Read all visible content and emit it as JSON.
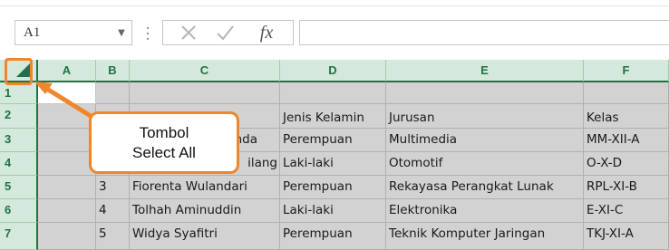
{
  "toolbar": {
    "name_box_value": "A1",
    "name_box_dropdown": "▼",
    "separator": "⋮",
    "cancel_icon": "close-icon",
    "enter_icon": "check-icon",
    "insert_function_label": "fx"
  },
  "grid": {
    "columns": [
      "A",
      "B",
      "C",
      "D",
      "E",
      "F"
    ],
    "rows": [
      "1",
      "2",
      "3",
      "4",
      "5",
      "6",
      "7"
    ],
    "cells": {
      "row1": {
        "A": "",
        "B": "",
        "C": "",
        "D": "",
        "E": "",
        "F": ""
      },
      "row2": {
        "A": "",
        "B": "",
        "C": "",
        "D": "Jenis Kelamin",
        "E": "Jurusan",
        "F": "Kelas"
      },
      "row3": {
        "A": "",
        "B": "",
        "C": "nda",
        "D": "Perempuan",
        "E": "Multimedia",
        "F": "MM-XII-A"
      },
      "row4": {
        "A": "",
        "B": "",
        "C": "ilang",
        "D": "Laki-laki",
        "E": "Otomotif",
        "F": "O-X-D"
      },
      "row5": {
        "A": "",
        "B": "3",
        "C": "Fiorenta Wulandari",
        "D": "Perempuan",
        "E": "Rekayasa Perangkat Lunak",
        "F": "RPL-XI-B"
      },
      "row6": {
        "A": "",
        "B": "4",
        "C": "Tolhah Aminuddin",
        "D": "Laki-laki",
        "E": "Elektronika",
        "F": "E-XI-C"
      },
      "row7": {
        "A": "",
        "B": "5",
        "C": "Widya Syafitri",
        "D": "Perempuan",
        "E": "Teknik Komputer Jaringan",
        "F": "TKJ-XI-A"
      }
    }
  },
  "callout": {
    "line1": "Tombol",
    "line2": "Select All"
  },
  "colors": {
    "accent_green": "#217346",
    "header_bg": "#d4e8dc",
    "selection_gray": "#d2d2d2",
    "callout_orange": "#f0862b"
  }
}
